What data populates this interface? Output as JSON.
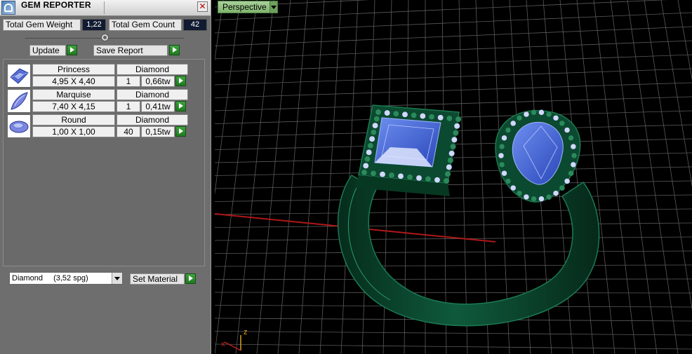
{
  "app": {
    "title": "GEM REPORTER",
    "close_icon": "close-icon"
  },
  "stats": {
    "total_weight_label": "Total Gem Weight",
    "total_weight_value": "1,22",
    "total_count_label": "Total Gem Count",
    "total_count_value": "42"
  },
  "actions": {
    "update_label": "Update",
    "save_report_label": "Save Report"
  },
  "gems": [
    {
      "cut": "Princess",
      "material": "Diamond",
      "size": "4,95 X 4,40",
      "qty": "1",
      "weight": "0,66tw",
      "icon": "princess-gem-icon"
    },
    {
      "cut": "Marquise",
      "material": "Diamond",
      "size": "7,40 X 4,15",
      "qty": "1",
      "weight": "0,41tw",
      "icon": "marquise-gem-icon"
    },
    {
      "cut": "Round",
      "material": "Diamond",
      "size": "1,00 X 1,00",
      "qty": "40",
      "weight": "0,15tw",
      "icon": "round-gem-icon"
    }
  ],
  "material": {
    "selected_name": "Diamond",
    "selected_density": "(3,52 spg)",
    "set_label": "Set Material"
  },
  "viewport": {
    "view_mode": "Perspective",
    "axis_z_label": "z"
  },
  "colors": {
    "metal": "#0f5a3c",
    "gem": "#3f63d6",
    "grid": "#5a5a5a",
    "accent_green": "#2a8a2a"
  }
}
